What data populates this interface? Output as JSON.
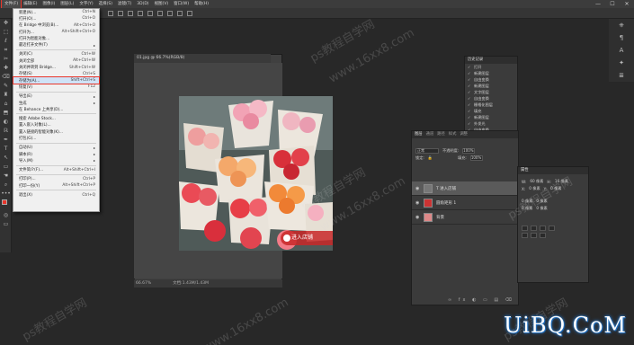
{
  "menubar": {
    "items": [
      "文件(F)",
      "编辑(E)",
      "图像(I)",
      "图层(L)",
      "文字(Y)",
      "选择(S)",
      "滤镜(T)",
      "3D(D)",
      "视图(V)",
      "窗口(W)",
      "帮助(H)"
    ],
    "active_index": 0
  },
  "window_controls": [
    "—",
    "☐",
    "✕"
  ],
  "file_menu": {
    "rows": [
      {
        "label": "新建(N)...",
        "shortcut": "Ctrl+N"
      },
      {
        "label": "打开(O)...",
        "shortcut": "Ctrl+O"
      },
      {
        "label": "在 Bridge 中浏览(B)...",
        "shortcut": "Alt+Ctrl+O"
      },
      {
        "label": "打开为...",
        "shortcut": "Alt+Shift+Ctrl+O"
      },
      {
        "label": "打开为智能对象...",
        "shortcut": ""
      },
      {
        "label": "最近打开文件(T)",
        "shortcut": "",
        "submenu": true
      },
      {
        "sep": true
      },
      {
        "label": "关闭(C)",
        "shortcut": "Ctrl+W"
      },
      {
        "label": "关闭全部",
        "shortcut": "Alt+Ctrl+W"
      },
      {
        "label": "关闭并转到 Bridge...",
        "shortcut": "Shift+Ctrl+W"
      },
      {
        "label": "存储(S)",
        "shortcut": "Ctrl+S"
      },
      {
        "label": "存储为(A)...",
        "shortcut": "Shift+Ctrl+S",
        "highlight": true
      },
      {
        "label": "恢复(V)",
        "shortcut": "F12"
      },
      {
        "sep": true
      },
      {
        "label": "导出(E)",
        "shortcut": "",
        "submenu": true
      },
      {
        "label": "生成",
        "shortcut": "",
        "submenu": true
      },
      {
        "label": "在 Behance 上共享(D)...",
        "shortcut": ""
      },
      {
        "sep": true
      },
      {
        "label": "搜索 Adobe Stock...",
        "shortcut": ""
      },
      {
        "label": "置入嵌入对象(L)...",
        "shortcut": ""
      },
      {
        "label": "置入链接的智能对象(K)...",
        "shortcut": ""
      },
      {
        "label": "打包(G)...",
        "shortcut": ""
      },
      {
        "sep": true
      },
      {
        "label": "自动(U)",
        "shortcut": "",
        "submenu": true
      },
      {
        "label": "脚本(R)",
        "shortcut": "",
        "submenu": true
      },
      {
        "label": "导入(M)",
        "shortcut": "",
        "submenu": true
      },
      {
        "sep": true
      },
      {
        "label": "文件简介(F)...",
        "shortcut": "Alt+Shift+Ctrl+I"
      },
      {
        "sep": true
      },
      {
        "label": "打印(P)...",
        "shortcut": "Ctrl+P"
      },
      {
        "label": "打印一份(Y)",
        "shortcut": "Alt+Shift+Ctrl+P"
      },
      {
        "sep": true
      },
      {
        "label": "退出(X)",
        "shortcut": "Ctrl+Q"
      }
    ]
  },
  "document": {
    "tab_title": "01.jpg @ 66.7%(RGB/8)",
    "zoom": "66.67%",
    "doc_info": "文档:1.43M/1.43M",
    "enter_button": "进入店铺"
  },
  "history_panel": {
    "tab": "历史记录",
    "rows": [
      "打开",
      "新建图层",
      "自由变换",
      "新建图层",
      "文字图层",
      "自由变换",
      "栅格化图层",
      "填充",
      "新建图层",
      "外发光",
      "自由变换",
      "新建图层",
      "修改 RGB 图层",
      "模糊",
      "复制图层"
    ]
  },
  "layers_panel": {
    "tabs": [
      "图层",
      "通道",
      "路径",
      "样式",
      "调整"
    ],
    "blend_mode": "正常",
    "opacity_label": "不透明度:",
    "opacity_value": "100%",
    "lock_label": "锁定:",
    "fill_label": "填充:",
    "fill_value": "100%",
    "layers": [
      {
        "name": "T 进入店铺",
        "selected": true
      },
      {
        "name": "圆角矩形 1",
        "selected": false
      },
      {
        "name": "背景",
        "selected": false
      }
    ]
  },
  "properties_panel": {
    "title": "属性",
    "w_label": "W:",
    "w_value": "60 像素",
    "h_label": "H:",
    "h_value": "16 像素",
    "x_label": "X:",
    "x_value": "0 像素",
    "y_label": "Y:",
    "y_value": "0 像素",
    "corner_values": [
      "0 像素",
      "0 像素",
      "0 像素",
      "0 像素"
    ]
  },
  "watermarks": [
    "ps教程自学网",
    "www.16xx8.com"
  ],
  "brand": "UiBQ.CoM",
  "tools": [
    "✥",
    "⬚",
    "ℓ",
    "⌗",
    "✂",
    "✚",
    "⌫",
    "✎",
    "♜",
    "⌂",
    "⬒",
    "◐",
    "ℝ",
    "✒",
    "T",
    "↖",
    "▭",
    "☚",
    "⌕",
    "•••"
  ],
  "dock_icons": [
    "⎈",
    "¶",
    "A",
    "✦",
    "≣"
  ],
  "colors": {
    "accent_red": "#e8362b",
    "fg_swatch": "#e8362b",
    "bg_swatch": "#ffffff"
  }
}
